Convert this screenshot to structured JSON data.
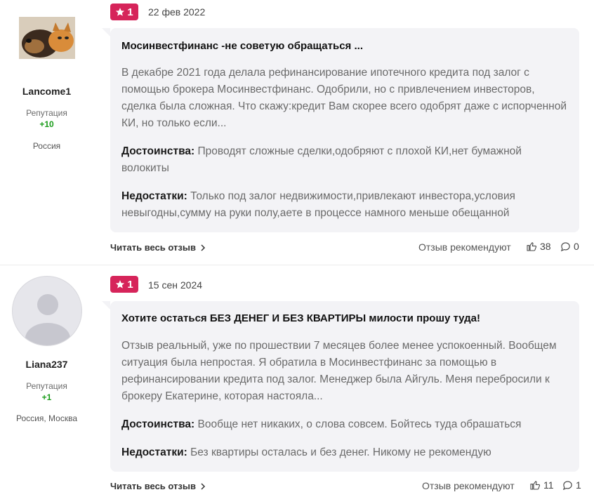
{
  "reviews": [
    {
      "user": {
        "name": "Lancome1",
        "reputation_label": "Репутация",
        "reputation_value": "+10",
        "location": "Россия",
        "avatar": "dog-cat-photo"
      },
      "rating": "1",
      "date": "22 фев 2022",
      "title": "Мосинвестфинанс -не советую обращаться ...",
      "text": "В декабре 2021 года делала рефинансирование ипотечного кредита под залог с помощью брокера Мосинвестфинанс. Одобрили, но с привлечением инвесторов, сделка была сложная. Что скажу:кредит Вам скорее всего одобрят даже с испорченной КИ, но только если...",
      "pros_label": "Достоинства:",
      "pros": "Проводят сложные сделки,одобряют с плохой КИ,нет бумажной волокиты",
      "cons_label": "Недостатки:",
      "cons": "Только под залог недвижимости,привлекают инвестора,условия невыгодны,сумму на руки полу,аете в процессе намного меньше обещанной",
      "read_more": "Читать весь отзыв",
      "recommend_label": "Отзыв рекомендуют",
      "likes": "38",
      "comments": "0"
    },
    {
      "user": {
        "name": "Liana237",
        "reputation_label": "Репутация",
        "reputation_value": "+1",
        "location": "Россия, Москва",
        "avatar": "default-avatar"
      },
      "rating": "1",
      "date": "15 сен 2024",
      "title": "Хотите остаться БЕЗ ДЕНЕГ И БЕЗ КВАРТИРЫ милости прошу туда!",
      "text": "Отзыв реальный, уже по прошествии 7 месяцев более менее успокоенный. Вообщем ситуация была непростая. Я обратила в Мосинвестфинанс за помощью в рефинансировании кредита под залог. Менеджер была Айгуль. Меня перебросили к брокеру Екатерине, которая настояла...",
      "pros_label": "Достоинства:",
      "pros": "Вообще нет никаких, о слова совсем. Бойтесь туда обрашаться",
      "cons_label": "Недостатки:",
      "cons": "Без квартиры осталась и без денег. Никому не рекомендую",
      "read_more": "Читать весь отзыв",
      "recommend_label": "Отзыв рекомендуют",
      "likes": "11",
      "comments": "1"
    }
  ],
  "colors": {
    "badge": "#d6245a",
    "reputation": "#1a9c1a",
    "bubble": "#f3f3f6"
  },
  "icons": [
    "star-icon",
    "chevron-right-icon",
    "thumbs-up-icon",
    "comment-icon"
  ]
}
